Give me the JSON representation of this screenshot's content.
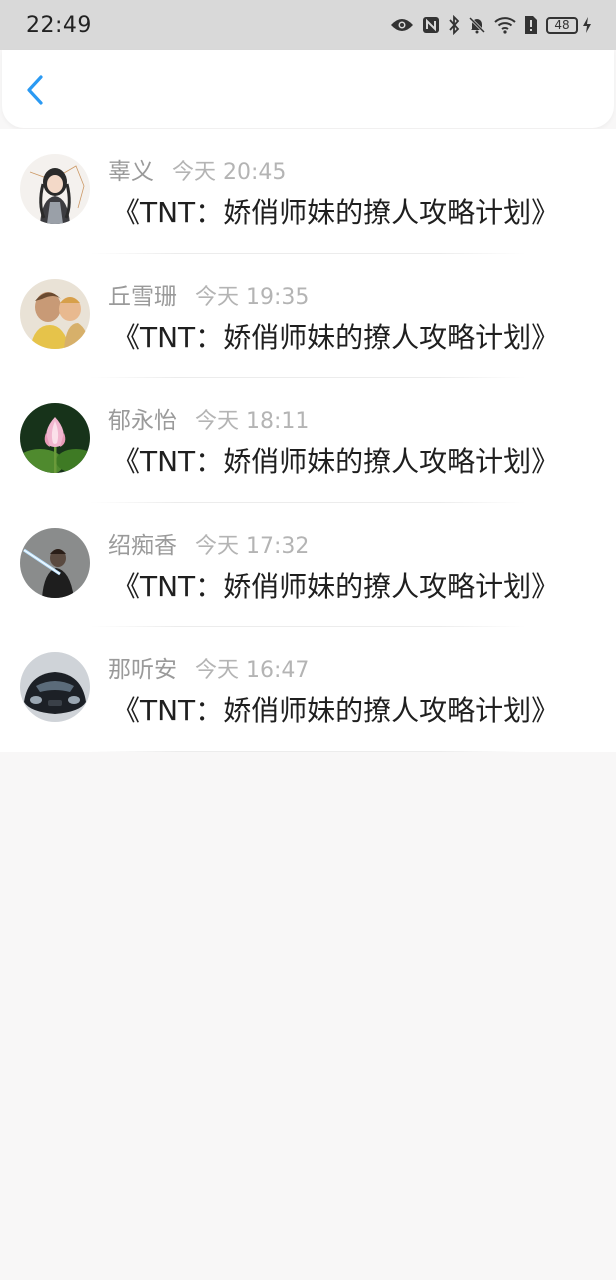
{
  "status_bar": {
    "time": "22:49",
    "battery": "48",
    "icons": [
      "eye-icon",
      "nfc-icon",
      "bluetooth-icon",
      "mute-bell-icon",
      "wifi-icon",
      "sim-alert-icon",
      "battery-icon",
      "charging-icon"
    ]
  },
  "nav": {
    "back_icon": "chevron-left-icon",
    "accent_color": "#2b9af3"
  },
  "items": [
    {
      "name": "辜义",
      "time": "今天 20:45",
      "title": "《TNT：娇俏师妹的撩人攻略计划》",
      "avatar": "anime-girl-avatar"
    },
    {
      "name": "丘雪珊",
      "time": "今天 19:35",
      "title": "《TNT：娇俏师妹的撩人攻略计划》",
      "avatar": "man-with-child-avatar"
    },
    {
      "name": "郁永怡",
      "time": "今天 18:11",
      "title": "《TNT：娇俏师妹的撩人攻略计划》",
      "avatar": "lotus-avatar"
    },
    {
      "name": "绍痴香",
      "time": "今天 17:32",
      "title": "《TNT：娇俏师妹的撩人攻略计划》",
      "avatar": "lightsaber-avatar"
    },
    {
      "name": "那听安",
      "time": "今天 16:47",
      "title": "《TNT：娇俏师妹的撩人攻略计划》",
      "avatar": "sports-car-avatar"
    }
  ]
}
